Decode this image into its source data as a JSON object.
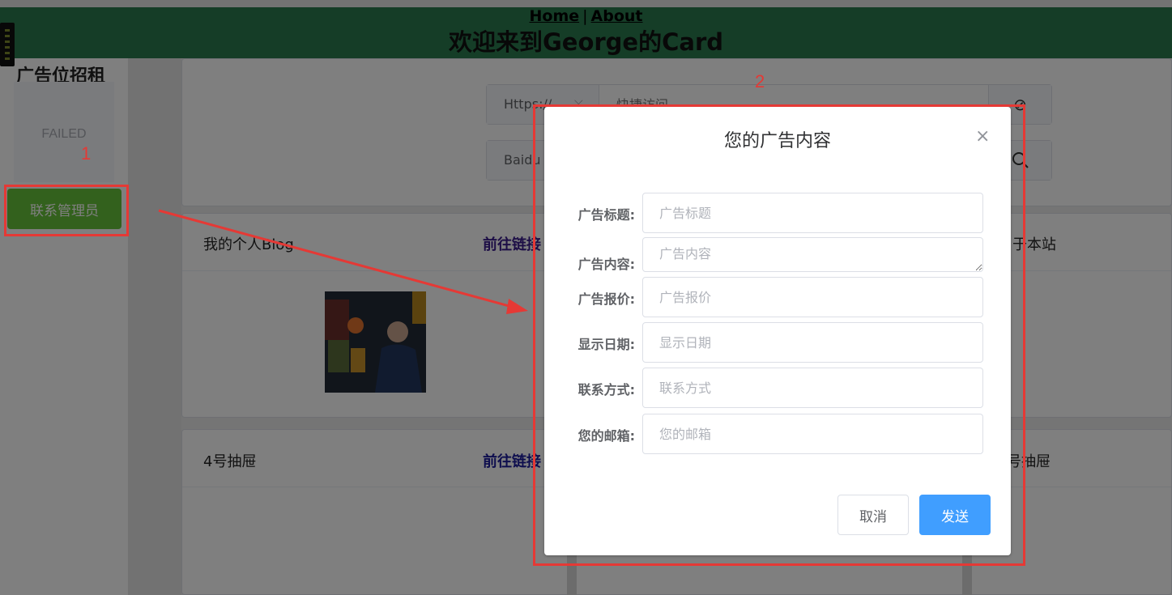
{
  "header": {
    "nav_home": "Home",
    "nav_separator": "|",
    "nav_about": "About",
    "title": "欢迎来到George的Card"
  },
  "sidebar": {
    "title": "广告位招租",
    "ad_status": "FAILED",
    "contact_button": "联系管理员"
  },
  "quick_access": {
    "protocol": "Https://",
    "placeholder": "快捷访问",
    "engine": "Baidu"
  },
  "cards": {
    "row1_label": "我的个人Blog",
    "row1_link": "前往链接",
    "row1_right": "于本站",
    "row2_label": "4号抽屉",
    "row2_link": "前往链接",
    "row2_right": "号抽屉"
  },
  "dialog": {
    "title": "您的广告内容",
    "close": "×",
    "fields": [
      {
        "label": "广告标题:",
        "placeholder": "广告标题"
      },
      {
        "label": "广告内容:",
        "placeholder": "广告内容"
      },
      {
        "label": "广告报价:",
        "placeholder": "广告报价"
      },
      {
        "label": "显示日期:",
        "placeholder": "显示日期"
      },
      {
        "label": "联系方式:",
        "placeholder": "联系方式"
      },
      {
        "label": "您的邮箱:",
        "placeholder": "您的邮箱"
      }
    ],
    "cancel": "取消",
    "send": "发送"
  },
  "annotations": {
    "label1": "1",
    "label2": "2",
    "color": "#e53935"
  }
}
